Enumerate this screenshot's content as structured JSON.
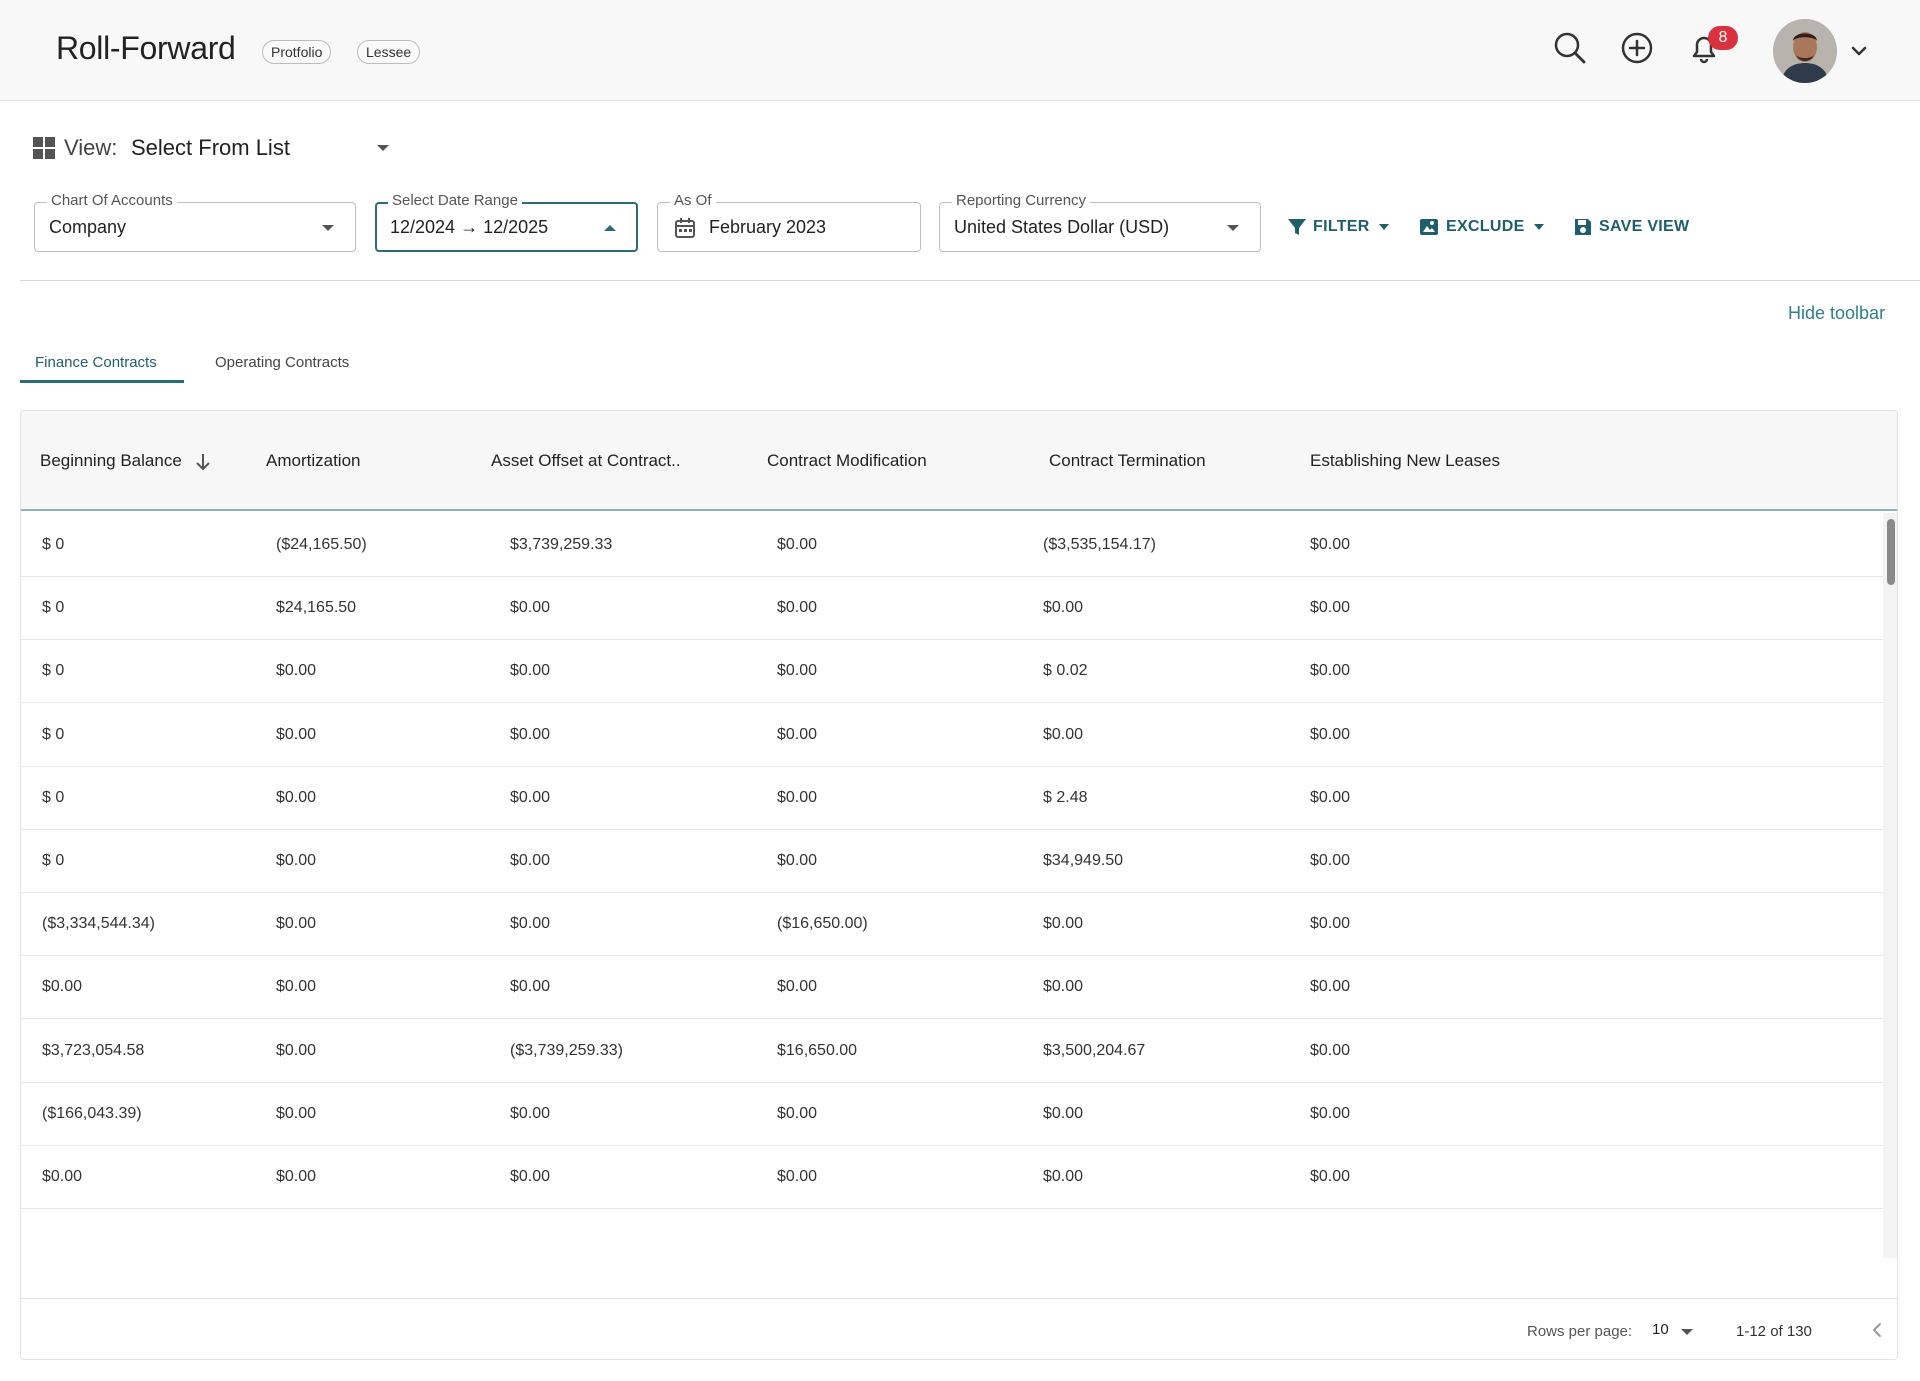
{
  "header": {
    "title": "Roll-Forward",
    "chips": [
      "Protfolio",
      "Lessee"
    ],
    "notification_count": "8"
  },
  "view": {
    "label": "View:",
    "value": "Select From List"
  },
  "fields": {
    "chart_of_accounts": {
      "label": "Chart Of Accounts",
      "value": "Company"
    },
    "date_range": {
      "label": "Select Date Range",
      "value": "12/2024 → 12/2025"
    },
    "as_of": {
      "label": "As Of",
      "value": "February 2023"
    },
    "currency": {
      "label": "Reporting Currency",
      "value": "United States Dollar (USD)"
    }
  },
  "toolbar": {
    "filter_label": "FILTER",
    "exclude_label": "EXCLUDE",
    "save_view_label": "SAVE VIEW",
    "hide_toolbar_label": "Hide toolbar"
  },
  "tabs": [
    {
      "label": "Finance Contracts",
      "active": true
    },
    {
      "label": "Operating Contracts",
      "active": false
    }
  ],
  "table": {
    "columns": [
      "Beginning Balance",
      "Amortization",
      "Asset Offset at Contract..",
      "Contract Modification",
      "Contract Termination",
      "Establishing New Leases"
    ],
    "rows": [
      [
        "$ 0",
        "($24,165.50)",
        "$3,739,259.33",
        "$0.00",
        "($3,535,154.17)",
        "$0.00"
      ],
      [
        "$ 0",
        "$24,165.50",
        "$0.00",
        "$0.00",
        "$0.00",
        "$0.00"
      ],
      [
        "$ 0",
        "$0.00",
        "$0.00",
        "$0.00",
        "$ 0.02",
        "$0.00"
      ],
      [
        "$ 0",
        "$0.00",
        "$0.00",
        "$0.00",
        "$0.00",
        "$0.00"
      ],
      [
        "$ 0",
        "$0.00",
        "$0.00",
        "$0.00",
        "$ 2.48",
        "$0.00"
      ],
      [
        "$ 0",
        "$0.00",
        "$0.00",
        "$0.00",
        "$34,949.50",
        "$0.00"
      ],
      [
        "($3,334,544.34)",
        "$0.00",
        "$0.00",
        "($16,650.00)",
        "$0.00",
        "$0.00"
      ],
      [
        "$0.00",
        "$0.00",
        "$0.00",
        "$0.00",
        "$0.00",
        "$0.00"
      ],
      [
        "$3,723,054.58",
        "$0.00",
        "($3,739,259.33)",
        "$16,650.00",
        "$3,500,204.67",
        "$0.00"
      ],
      [
        "($166,043.39)",
        "$0.00",
        "$0.00",
        "$0.00",
        "$0.00",
        "$0.00"
      ],
      [
        "$0.00",
        "$0.00",
        "$0.00",
        "$0.00",
        "$0.00",
        "$0.00"
      ]
    ]
  },
  "pagination": {
    "rows_per_page_label": "Rows per page:",
    "rows_per_page_value": "10",
    "range_text": "1-12 of 130"
  },
  "colors": {
    "accent": "#2b6c78",
    "badge": "#d9313d"
  }
}
